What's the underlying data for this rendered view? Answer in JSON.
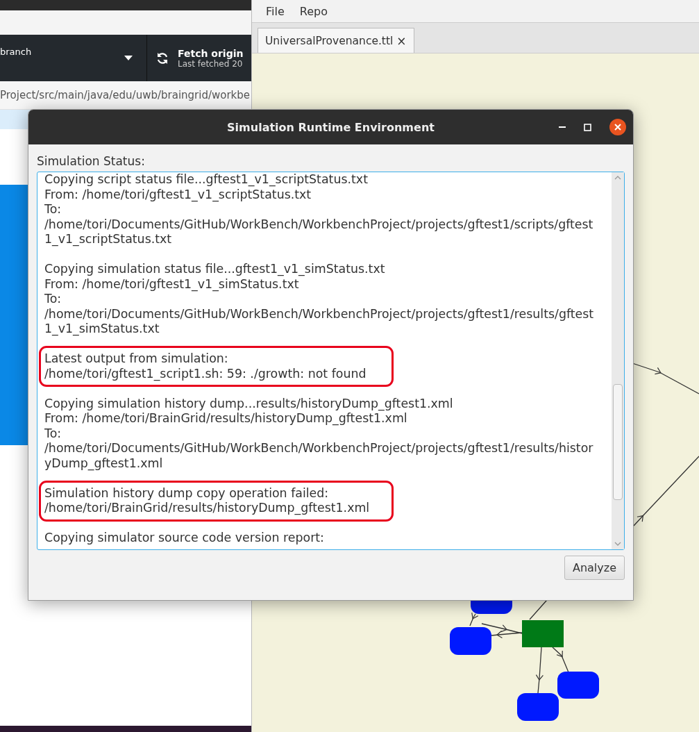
{
  "left_app": {
    "branch_button": {
      "label": "branch"
    },
    "fetch_button": {
      "title": "Fetch origin",
      "subtitle": "Last fetched 20"
    },
    "path": "Project/src/main/java/edu/uwb/braingrid/workbe"
  },
  "right_app": {
    "menu": [
      "File",
      "Repo"
    ],
    "tabs": [
      {
        "label": "UniversalProvenance.ttl",
        "close": "×",
        "selected": true
      }
    ]
  },
  "dialog": {
    "title": "Simulation Runtime Environment",
    "status_label": "Simulation Status:",
    "log": [
      {
        "highlighted": false,
        "lines": [
          "Copying script status file...gftest1_v1_scriptStatus.txt",
          "From: /home/tori/gftest1_v1_scriptStatus.txt",
          "To:",
          "/home/tori/Documents/GitHub/WorkBench/WorkbenchProject/projects/gftest1/scripts/gftest",
          "1_v1_scriptStatus.txt"
        ]
      },
      {
        "highlighted": false,
        "lines": [
          "Copying simulation status file...gftest1_v1_simStatus.txt",
          "From: /home/tori/gftest1_v1_simStatus.txt",
          "To:",
          "/home/tori/Documents/GitHub/WorkBench/WorkbenchProject/projects/gftest1/results/gftest",
          "1_v1_simStatus.txt"
        ]
      },
      {
        "highlighted": true,
        "lines": [
          "Latest output from simulation:",
          "/home/tori/gftest1_script1.sh: 59: ./growth: not found"
        ]
      },
      {
        "highlighted": false,
        "lines": [
          "Copying simulation history dump...results/historyDump_gftest1.xml",
          "From: /home/tori/BrainGrid/results/historyDump_gftest1.xml",
          "To:",
          "/home/tori/Documents/GitHub/WorkBench/WorkbenchProject/projects/gftest1/results/histor",
          "yDump_gftest1.xml"
        ]
      },
      {
        "highlighted": true,
        "lines": [
          "Simulation history dump copy operation failed:",
          "/home/tori/BrainGrid/results/historyDump_gftest1.xml"
        ]
      },
      {
        "highlighted": false,
        "lines": [
          "Copying simulator source code version report:"
        ]
      }
    ],
    "buttons": [
      "Analyze"
    ]
  }
}
